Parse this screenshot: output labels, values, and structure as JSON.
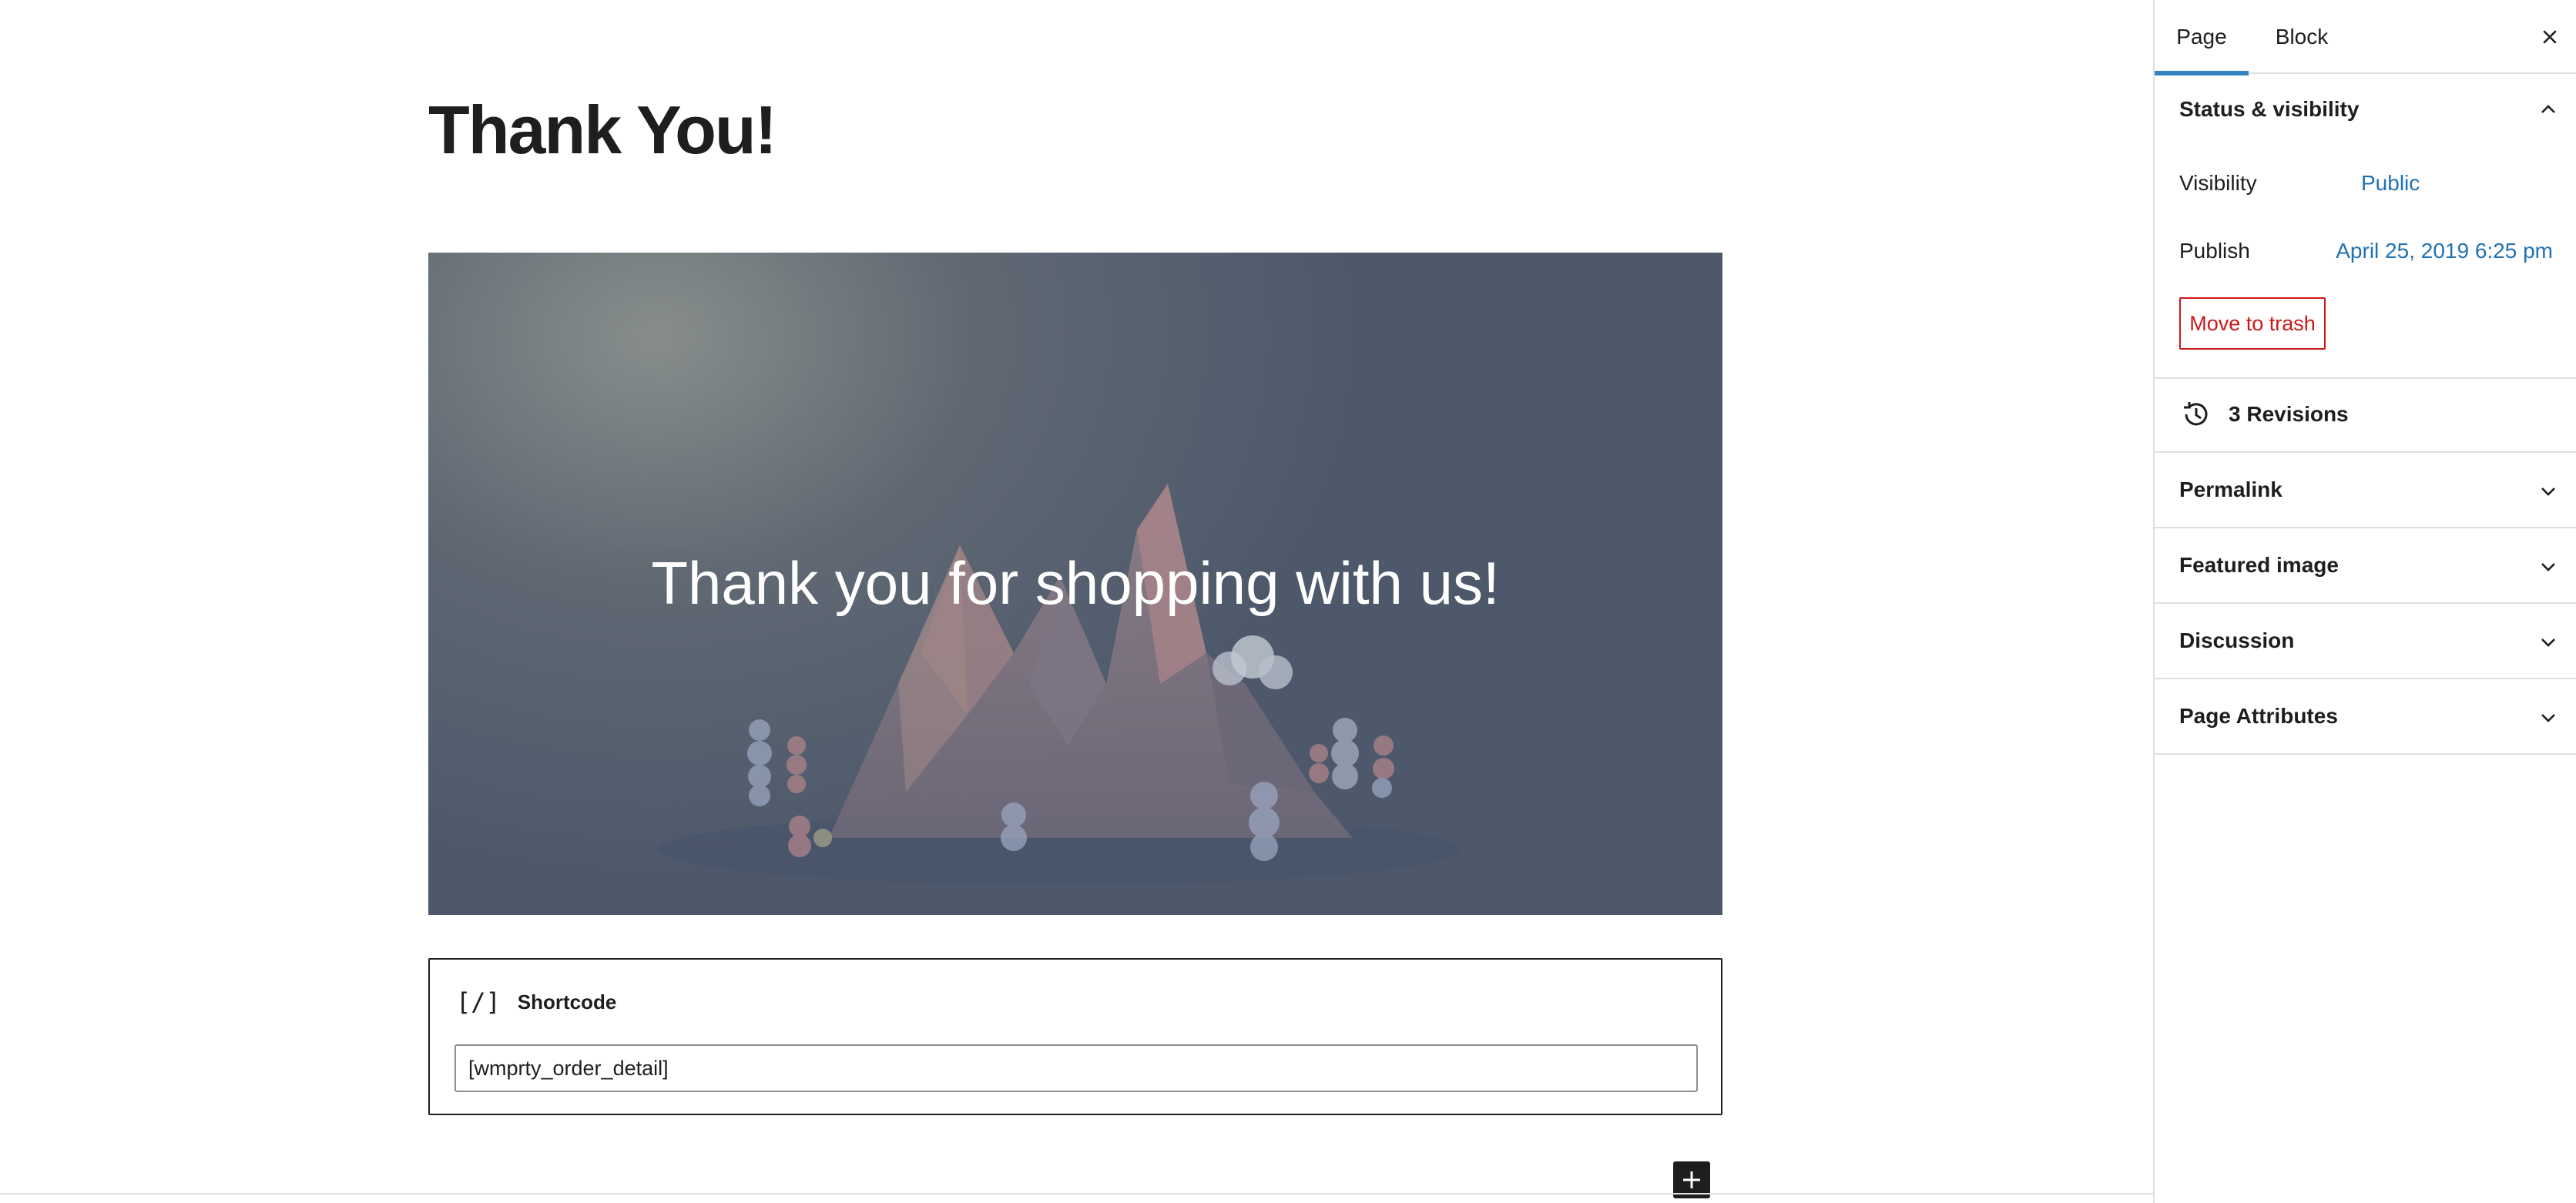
{
  "editor": {
    "page_title": "Thank You!",
    "cover_text": "Thank you for shopping with us!",
    "shortcode": {
      "icon_glyph": "[/]",
      "title": "Shortcode",
      "value": "[wmprty_order_detail]"
    },
    "inserter_icon": "plus-icon"
  },
  "sidebar": {
    "tabs": [
      {
        "label": "Page",
        "active": true
      },
      {
        "label": "Block",
        "active": false
      }
    ],
    "close_icon": "close-icon",
    "status_panel": {
      "title": "Status & visibility",
      "visibility_label": "Visibility",
      "visibility_value": "Public",
      "publish_label": "Publish",
      "publish_value": "April 25, 2019 6:25 pm",
      "trash_label": "Move to trash"
    },
    "revisions_label": "3 Revisions",
    "panels": [
      {
        "title": "Permalink"
      },
      {
        "title": "Featured image"
      },
      {
        "title": "Discussion"
      },
      {
        "title": "Page Attributes"
      }
    ]
  },
  "colors": {
    "accent": "#3582c4",
    "link": "#2271b1",
    "danger": "#cc1818",
    "text": "#1e1e1e",
    "border": "#e0e0e0"
  }
}
